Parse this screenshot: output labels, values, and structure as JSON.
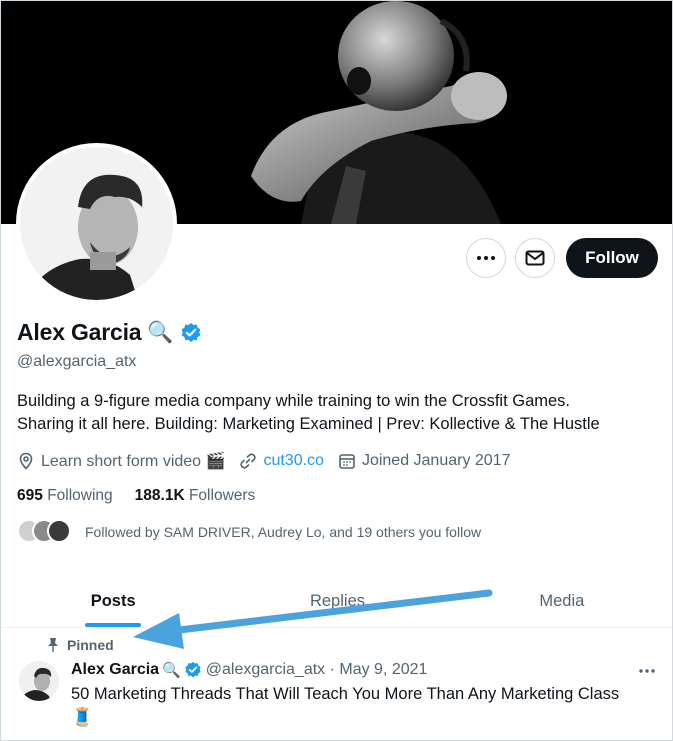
{
  "profile": {
    "name": "Alex Garcia",
    "name_emoji": "🔍",
    "handle": "@alexgarcia_atx",
    "bio_line1": "Building a 9-figure media company while training to win the Crossfit Games.",
    "bio_line2": "Sharing it all here. Building: Marketing Examined | Prev: Kollective & The Hustle",
    "location": "Learn short form video 🎬",
    "link": "cut30.co",
    "joined": "Joined January 2017",
    "following_count": "695",
    "following_label": "Following",
    "followers_count": "188.1K",
    "followers_label": "Followers",
    "followed_by": "Followed by SAM DRIVER, Audrey Lo, and 19 others you follow"
  },
  "actions": {
    "follow_label": "Follow",
    "more_icon": "more-icon",
    "message_icon": "mail-icon"
  },
  "tabs": [
    {
      "label": "Posts",
      "active": true
    },
    {
      "label": "Replies",
      "active": false
    },
    {
      "label": "Media",
      "active": false
    }
  ],
  "pinned_tweet": {
    "pinned_label": "Pinned",
    "author": "Alex Garcia",
    "author_emoji": "🔍",
    "meta": "@alexgarcia_atx · May 9, 2021",
    "text": "50 Marketing Threads That Will Teach You More Than Any Marketing Class",
    "trailing_emoji": "🧵"
  },
  "colors": {
    "accent": "#1d9bf0",
    "text_primary": "#0f1419",
    "text_secondary": "#536471",
    "annotation_arrow": "#4aa3dc"
  }
}
